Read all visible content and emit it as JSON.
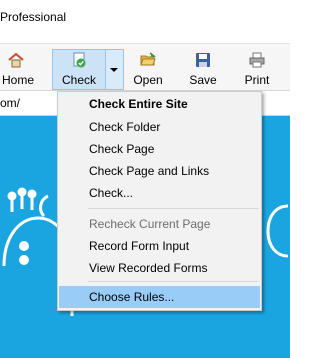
{
  "window": {
    "title": "Professional"
  },
  "toolbar": {
    "home_label": "Home",
    "check_label": "Check",
    "open_label": "Open",
    "save_label": "Save",
    "print_label": "Print"
  },
  "address": {
    "value": "om/"
  },
  "menu": {
    "items": [
      {
        "label": "Check Entire Site"
      },
      {
        "label": "Check Folder"
      },
      {
        "label": "Check Page"
      },
      {
        "label": "Check Page and Links"
      },
      {
        "label": "Check..."
      },
      {
        "label": "Recheck Current Page"
      },
      {
        "label": "Record Form Input"
      },
      {
        "label": "View Recorded Forms"
      },
      {
        "label": "Choose Rules..."
      }
    ]
  },
  "colors": {
    "content_bg": "#1ba5e0",
    "menu_bg": "#f2f2f2",
    "menu_hover": "#99ccf7",
    "check_button_bg": "#cce3f7"
  },
  "icons": {
    "home": "home-icon",
    "check": "check-page-icon",
    "open": "open-folder-icon",
    "save": "save-disk-icon",
    "print": "printer-icon"
  }
}
